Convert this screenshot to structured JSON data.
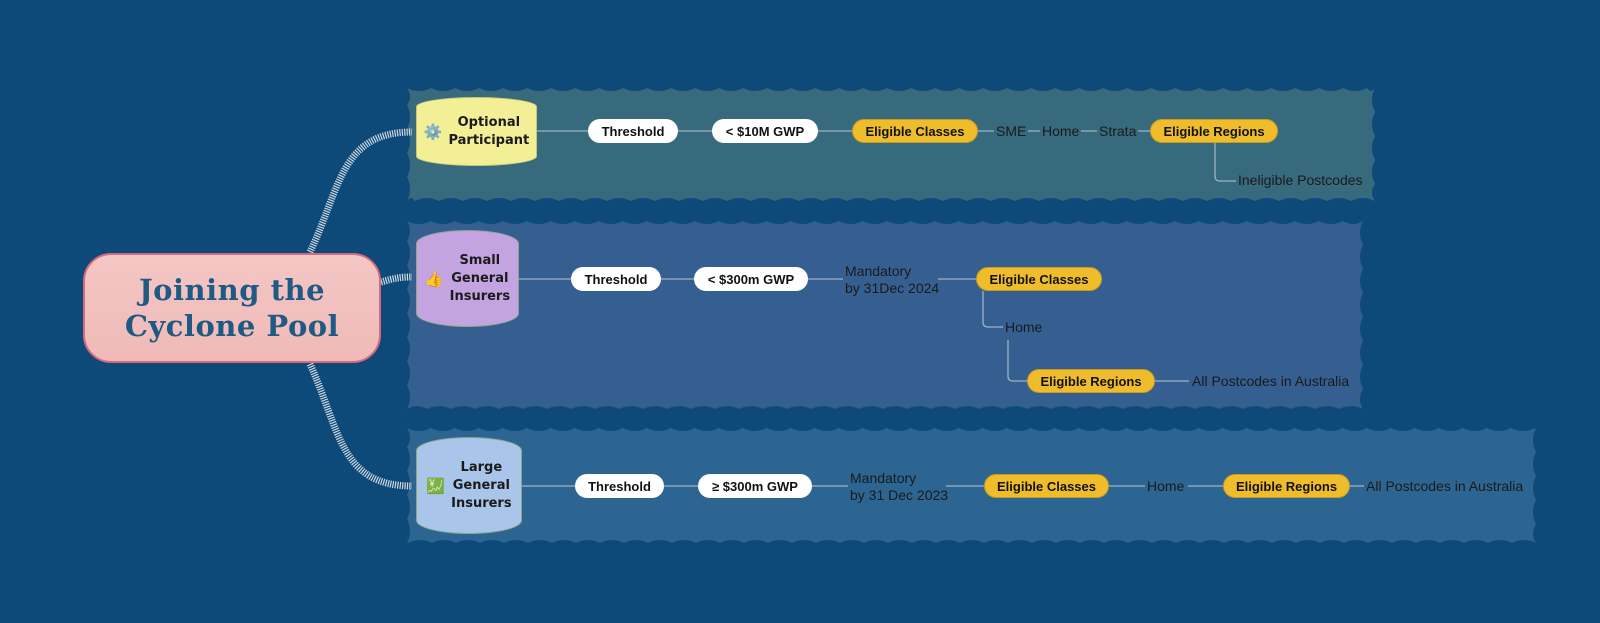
{
  "title": "Joining the Cyclone Pool",
  "colors": {
    "background": "#0d4a7a",
    "root_fill": "#f2bebc",
    "root_border": "#d46a7e",
    "root_text": "#1f5a85",
    "eligible_pill": "#efbd2c",
    "threshold_pill": "#ffffff",
    "band_optional": "#386a7e",
    "band_small": "#355f91",
    "band_large": "#2c6591"
  },
  "branches": [
    {
      "id": "optional",
      "label": "Optional Participant",
      "label_lines": [
        "Optional",
        "Participant"
      ],
      "icon": "gear-icon",
      "icon_glyph": "⚙️",
      "node_color": "#f3ef96",
      "threshold_label": "Threshold",
      "threshold_value": "< $10M GWP",
      "classes_label": "Eligible  Classes",
      "classes": [
        "SME",
        "Home",
        "Strata"
      ],
      "regions_label": "Eligible  Regions",
      "regions": "Ineligible Postcodes"
    },
    {
      "id": "small",
      "label": "Small General Insurers",
      "label_lines": [
        "Small",
        "General",
        "Insurers"
      ],
      "icon": "thumbs-up-icon",
      "icon_glyph": "👍",
      "node_color": "#c3a3e0",
      "threshold_label": "Threshold",
      "threshold_value": "< $300m GWP",
      "mandatory_lines": [
        "Mandatory",
        "by 31Dec 2024"
      ],
      "classes_label": "Eligible  Classes",
      "classes": [
        "Home"
      ],
      "regions_label": "Eligible  Regions",
      "regions": "All Postcodes in Australia"
    },
    {
      "id": "large",
      "label": "Large General Insurers",
      "label_lines": [
        "Large",
        "General",
        "Insurers"
      ],
      "icon": "chart-icon",
      "icon_glyph": "💹",
      "node_color": "#a9c6ea",
      "threshold_label": "Threshold",
      "threshold_value": "≥ $300m GWP",
      "mandatory_lines": [
        "Mandatory",
        "by 31 Dec 2023"
      ],
      "classes_label": "Eligible  Classes",
      "classes": [
        "Home"
      ],
      "regions_label": "Eligible  Regions",
      "regions": "All Postcodes in Australia"
    }
  ]
}
